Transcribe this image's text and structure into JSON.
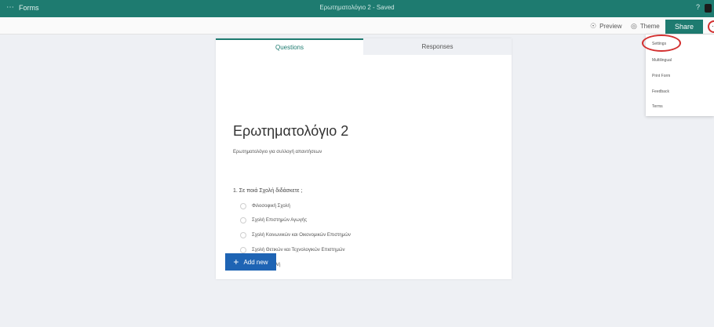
{
  "appbar": {
    "app_name": "Forms",
    "document_title": "Ερωτηματολόγιο 2 - Saved",
    "waffle_icon": "waffle-icon",
    "help_icon": "help-icon"
  },
  "commandbar": {
    "preview_label": "Preview",
    "theme_label": "Theme",
    "share_label": "Share",
    "preview_icon": "eye-icon",
    "theme_icon": "palette-icon"
  },
  "tabs": {
    "questions": "Questions",
    "responses": "Responses"
  },
  "form": {
    "title": "Ερωτηματολόγιο 2",
    "subtitle": "Ερωτηματολόγιο για συλλογή απαντήσεων",
    "question": "1. Σε ποιά Σχολή διδάσκετε ;",
    "options": [
      "Φιλοσοφική Σχολή",
      "Σχολή Επιστημών Αγωγής",
      "Σχολή Κοινωνικών και Οικονομικών Επιστημών",
      "Σχολή Θετικών και Τεχνολογικών Επιστημών",
      "Ιατρική Σχολή"
    ],
    "add_new_label": "Add new"
  },
  "menu": {
    "items": [
      "Settings",
      "Multilingual",
      "Print Form",
      "Feedback",
      "Terms"
    ]
  },
  "colors": {
    "brand": "#1e7b70",
    "add_button": "#1e64b4",
    "annotation": "#d32f2f"
  }
}
